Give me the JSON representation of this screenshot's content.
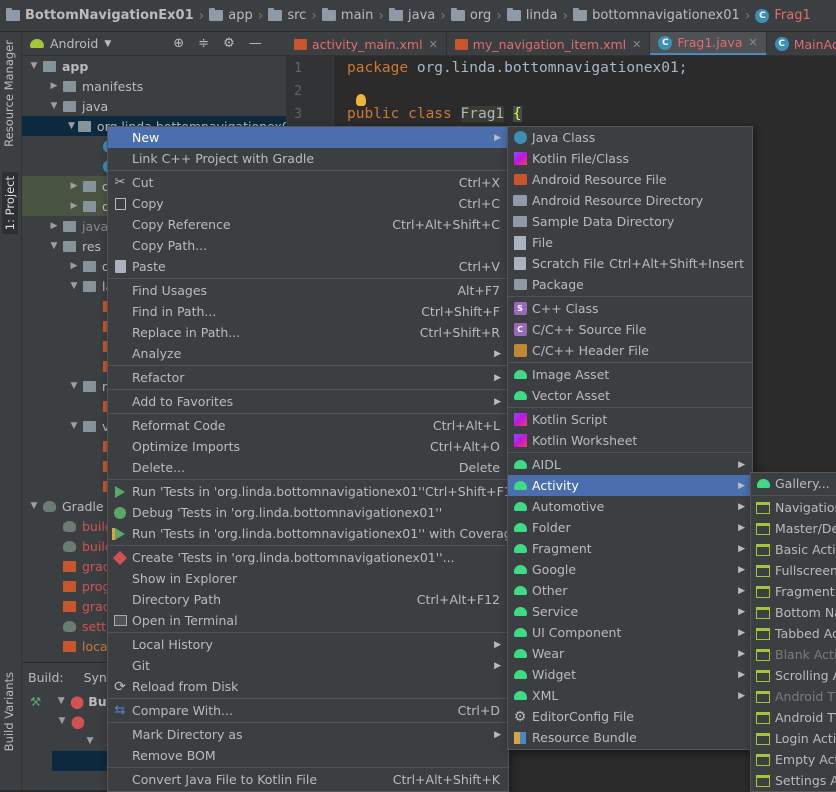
{
  "breadcrumb": [
    "BottomNavigationEx01",
    "app",
    "src",
    "main",
    "java",
    "org",
    "linda",
    "bottomnavigationex01",
    "Frag1"
  ],
  "left_strip": {
    "resource_manager": "Resource Manager",
    "project": "1: Project",
    "build_variants": "Build Variants"
  },
  "project_panel": {
    "view_selector": "Android",
    "tree": [
      {
        "label": "app",
        "level": 0,
        "type": "module",
        "expanded": true
      },
      {
        "label": "manifests",
        "level": 1,
        "type": "folder",
        "expanded": false
      },
      {
        "label": "java",
        "level": 1,
        "type": "folder",
        "expanded": true
      },
      {
        "label": "org.linda.bottomnavigationex01",
        "level": 2,
        "type": "package",
        "expanded": true,
        "selected": true
      },
      {
        "label": "F",
        "level": 3,
        "type": "class",
        "color": "red"
      },
      {
        "label": "M",
        "level": 3,
        "type": "class",
        "color": "red"
      },
      {
        "label": "org.l",
        "level": 2,
        "type": "package",
        "expanded": false,
        "highlight": true
      },
      {
        "label": "org.l",
        "level": 2,
        "type": "package",
        "expanded": false,
        "highlight": true
      },
      {
        "label": "java (ge",
        "level": 1,
        "type": "folder",
        "expanded": false,
        "dim": true
      },
      {
        "label": "res",
        "level": 1,
        "type": "folder",
        "expanded": true
      },
      {
        "label": "draw",
        "level": 2,
        "type": "folder",
        "expanded": false
      },
      {
        "label": "layo",
        "level": 2,
        "type": "folder",
        "expanded": true
      },
      {
        "label": "a",
        "level": 3,
        "type": "xml",
        "color": "orange"
      },
      {
        "label": "f",
        "level": 3,
        "type": "xml",
        "color": "orange"
      },
      {
        "label": "f",
        "level": 3,
        "type": "xml",
        "color": "orange"
      },
      {
        "label": "f",
        "level": 3,
        "type": "xml",
        "color": "orange"
      },
      {
        "label": "men",
        "level": 2,
        "type": "folder",
        "expanded": true
      },
      {
        "label": "n",
        "level": 3,
        "type": "xml",
        "color": "orange"
      },
      {
        "label": "valu",
        "level": 2,
        "type": "folder",
        "expanded": true
      },
      {
        "label": "c",
        "level": 3,
        "type": "xml",
        "color": "orange"
      },
      {
        "label": "s",
        "level": 3,
        "type": "xml",
        "color": "orange"
      },
      {
        "label": "s",
        "level": 3,
        "type": "xml",
        "color": "orange"
      },
      {
        "label": "Gradle Scri",
        "level": 0,
        "type": "gradle",
        "expanded": true
      },
      {
        "label": "build.gr",
        "level": 1,
        "type": "gradle-file",
        "color": "red"
      },
      {
        "label": "build.gr",
        "level": 1,
        "type": "gradle-file",
        "color": "red"
      },
      {
        "label": "gradle-w",
        "level": 1,
        "type": "file",
        "color": "red"
      },
      {
        "label": "proguar",
        "level": 1,
        "type": "file",
        "color": "red"
      },
      {
        "label": "gradle.p",
        "level": 1,
        "type": "file",
        "color": "red"
      },
      {
        "label": "settings",
        "level": 1,
        "type": "gradle-file",
        "color": "red"
      },
      {
        "label": "local.pro",
        "level": 1,
        "type": "file",
        "color": "orange"
      }
    ]
  },
  "build_panel": {
    "tab_build": "Build:",
    "tab_sync": "Sync",
    "row1": "Bui",
    "row2": ""
  },
  "editor": {
    "tabs": [
      {
        "label": "activity_main.xml",
        "active": false
      },
      {
        "label": "my_navigation_item.xml",
        "active": false
      },
      {
        "label": "Frag1.java",
        "active": true
      },
      {
        "label": "MainActivity.java",
        "active": false
      }
    ],
    "line_numbers": [
      "1",
      "2",
      "3"
    ],
    "line1": {
      "kw": "package",
      "rest": " org.linda.bottomnavigationex01;"
    },
    "line3": {
      "kw": "public class",
      "name": "Frag1",
      "brace": "{"
    }
  },
  "context_menu": [
    {
      "label": "New",
      "submenu": true,
      "highlight": true,
      "icon": ""
    },
    {
      "label": "Link C++ Project with Gradle",
      "icon": ""
    },
    {
      "sep": true
    },
    {
      "label": "Cut",
      "shortcut": "Ctrl+X",
      "icon": "cut-icon"
    },
    {
      "label": "Copy",
      "shortcut": "Ctrl+C",
      "icon": "copy-icon"
    },
    {
      "label": "Copy Reference",
      "shortcut": "Ctrl+Alt+Shift+C",
      "icon": ""
    },
    {
      "label": "Copy Path...",
      "icon": ""
    },
    {
      "label": "Paste",
      "shortcut": "Ctrl+V",
      "icon": "paste-icon"
    },
    {
      "sep": true
    },
    {
      "label": "Find Usages",
      "shortcut": "Alt+F7",
      "icon": ""
    },
    {
      "label": "Find in Path...",
      "shortcut": "Ctrl+Shift+F",
      "icon": ""
    },
    {
      "label": "Replace in Path...",
      "shortcut": "Ctrl+Shift+R",
      "icon": ""
    },
    {
      "label": "Analyze",
      "submenu": true,
      "icon": ""
    },
    {
      "sep": true
    },
    {
      "label": "Refactor",
      "submenu": true,
      "icon": ""
    },
    {
      "sep": true
    },
    {
      "label": "Add to Favorites",
      "submenu": true,
      "icon": ""
    },
    {
      "sep": true
    },
    {
      "label": "Reformat Code",
      "shortcut": "Ctrl+Alt+L",
      "icon": ""
    },
    {
      "label": "Optimize Imports",
      "shortcut": "Ctrl+Alt+O",
      "icon": ""
    },
    {
      "label": "Delete...",
      "shortcut": "Delete",
      "icon": ""
    },
    {
      "sep": true
    },
    {
      "label": "Run 'Tests in 'org.linda.bottomnavigationex01''",
      "shortcut": "Ctrl+Shift+F10",
      "icon": "run-icon"
    },
    {
      "label": "Debug 'Tests in 'org.linda.bottomnavigationex01''",
      "icon": "debug-icon"
    },
    {
      "label": "Run 'Tests in 'org.linda.bottomnavigationex01'' with Coverage",
      "icon": "coverage-icon"
    },
    {
      "sep": true
    },
    {
      "label": "Create 'Tests in 'org.linda.bottomnavigationex01''...",
      "icon": "create-test-icon"
    },
    {
      "label": "Show in Explorer",
      "icon": ""
    },
    {
      "label": "Directory Path",
      "shortcut": "Ctrl+Alt+F12",
      "icon": ""
    },
    {
      "label": "Open in Terminal",
      "icon": "terminal-icon"
    },
    {
      "sep": true
    },
    {
      "label": "Local History",
      "submenu": true,
      "icon": ""
    },
    {
      "label": "Git",
      "submenu": true,
      "icon": ""
    },
    {
      "label": "Reload from Disk",
      "icon": "reload-icon"
    },
    {
      "sep": true
    },
    {
      "label": "Compare With...",
      "shortcut": "Ctrl+D",
      "icon": "compare-icon"
    },
    {
      "sep": true
    },
    {
      "label": "Mark Directory as",
      "submenu": true,
      "icon": ""
    },
    {
      "label": "Remove BOM",
      "icon": ""
    },
    {
      "sep": true
    },
    {
      "label": "Convert Java File to Kotlin File",
      "shortcut": "Ctrl+Alt+Shift+K",
      "icon": ""
    }
  ],
  "new_submenu": [
    {
      "label": "Java Class",
      "icon": "java-class-icon"
    },
    {
      "label": "Kotlin File/Class",
      "icon": "kotlin-icon"
    },
    {
      "label": "Android Resource File",
      "icon": "resource-file-icon"
    },
    {
      "label": "Android Resource Directory",
      "icon": "folder-icon"
    },
    {
      "label": "Sample Data Directory",
      "icon": "folder-icon"
    },
    {
      "label": "File",
      "icon": "file-icon"
    },
    {
      "label": "Scratch File",
      "shortcut": "Ctrl+Alt+Shift+Insert",
      "icon": "scratch-icon"
    },
    {
      "label": "Package",
      "icon": "package-icon"
    },
    {
      "sep": true
    },
    {
      "label": "C++ Class",
      "icon": "cpp-class-icon"
    },
    {
      "label": "C/C++ Source File",
      "icon": "cpp-source-icon"
    },
    {
      "label": "C/C++ Header File",
      "icon": "cpp-header-icon"
    },
    {
      "sep": true
    },
    {
      "label": "Image Asset",
      "icon": "android-icon"
    },
    {
      "label": "Vector Asset",
      "icon": "android-icon"
    },
    {
      "sep": true
    },
    {
      "label": "Kotlin Script",
      "icon": "kotlin-icon"
    },
    {
      "label": "Kotlin Worksheet",
      "icon": "kotlin-icon"
    },
    {
      "sep": true
    },
    {
      "label": "AIDL",
      "submenu": true,
      "icon": "android-icon"
    },
    {
      "label": "Activity",
      "submenu": true,
      "highlight": true,
      "icon": "android-icon"
    },
    {
      "label": "Automotive",
      "submenu": true,
      "icon": "android-icon"
    },
    {
      "label": "Folder",
      "submenu": true,
      "icon": "android-icon"
    },
    {
      "label": "Fragment",
      "submenu": true,
      "icon": "android-icon"
    },
    {
      "label": "Google",
      "submenu": true,
      "icon": "android-icon"
    },
    {
      "label": "Other",
      "submenu": true,
      "icon": "android-icon"
    },
    {
      "label": "Service",
      "submenu": true,
      "icon": "android-icon"
    },
    {
      "label": "UI Component",
      "submenu": true,
      "icon": "android-icon"
    },
    {
      "label": "Wear",
      "submenu": true,
      "icon": "android-icon"
    },
    {
      "label": "Widget",
      "submenu": true,
      "icon": "android-icon"
    },
    {
      "label": "XML",
      "submenu": true,
      "icon": "android-icon"
    },
    {
      "label": "EditorConfig File",
      "icon": "editorconfig-icon"
    },
    {
      "label": "Resource Bundle",
      "icon": "resource-bundle-icon"
    }
  ],
  "activity_submenu": [
    {
      "label": "Gallery...",
      "icon": "android-icon"
    },
    {
      "sep": true
    },
    {
      "label": "Navigation",
      "icon": "template-icon"
    },
    {
      "label": "Master/Deta",
      "icon": "template-icon"
    },
    {
      "label": "Basic Activi",
      "icon": "template-icon"
    },
    {
      "label": "Fullscreen A",
      "icon": "template-icon"
    },
    {
      "label": "Fragment +",
      "icon": "template-icon"
    },
    {
      "label": "Bottom Nav",
      "icon": "template-icon"
    },
    {
      "label": "Tabbed Act",
      "icon": "template-icon"
    },
    {
      "label": "Blank Activi",
      "icon": "template-icon",
      "disabled": true
    },
    {
      "label": "Scrolling Ac",
      "icon": "template-icon"
    },
    {
      "label": "Android Thi",
      "icon": "template-icon",
      "disabled": true
    },
    {
      "label": "Android TV",
      "icon": "template-icon"
    },
    {
      "label": "Login Activi",
      "icon": "template-icon"
    },
    {
      "label": "Empty Activ",
      "icon": "template-icon"
    },
    {
      "label": "Settings Ac",
      "icon": "template-icon"
    }
  ]
}
